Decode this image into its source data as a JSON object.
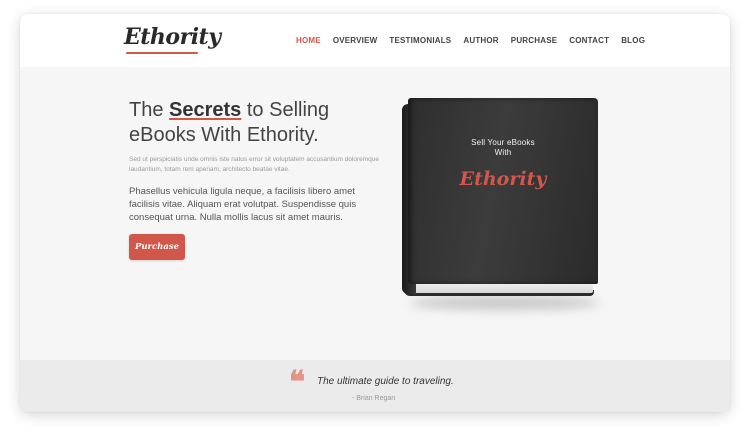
{
  "header": {
    "logo": "Ethority",
    "nav": [
      "HOME",
      "OVERVIEW",
      "TESTIMONIALS",
      "AUTHOR",
      "PURCHASE",
      "CONTACT",
      "BLOG"
    ],
    "active_nav": "HOME"
  },
  "hero": {
    "title_prefix": "The ",
    "title_strong": "Secrets",
    "title_suffix": " to Selling eBooks With Ethority.",
    "small_text": "Sed ut perspiciatis unde omnis iste natus error sit voluptatem accusantium doloremque laudantium, totam rem aperiam, architecto beatae vitae.",
    "body_text": "Phasellus vehicula ligula neque, a facilisis libero amet facilisis vitae. Aliquam erat volutpat. Suspendisse quis consequat urna. Nulla mollis lacus sit amet mauris.",
    "purchase_label": "Purchase"
  },
  "book": {
    "cover_line1": "Sell Your eBooks",
    "cover_line2": "With",
    "cover_logo": "Ethority"
  },
  "testimonial": {
    "quote_mark": "❝",
    "quote": "The ultimate guide to traveling.",
    "author": "- Brian Regan"
  },
  "colors": {
    "accent": "#d1574a",
    "background": "#f6f6f6",
    "testimonial_bg": "#ebebeb"
  }
}
